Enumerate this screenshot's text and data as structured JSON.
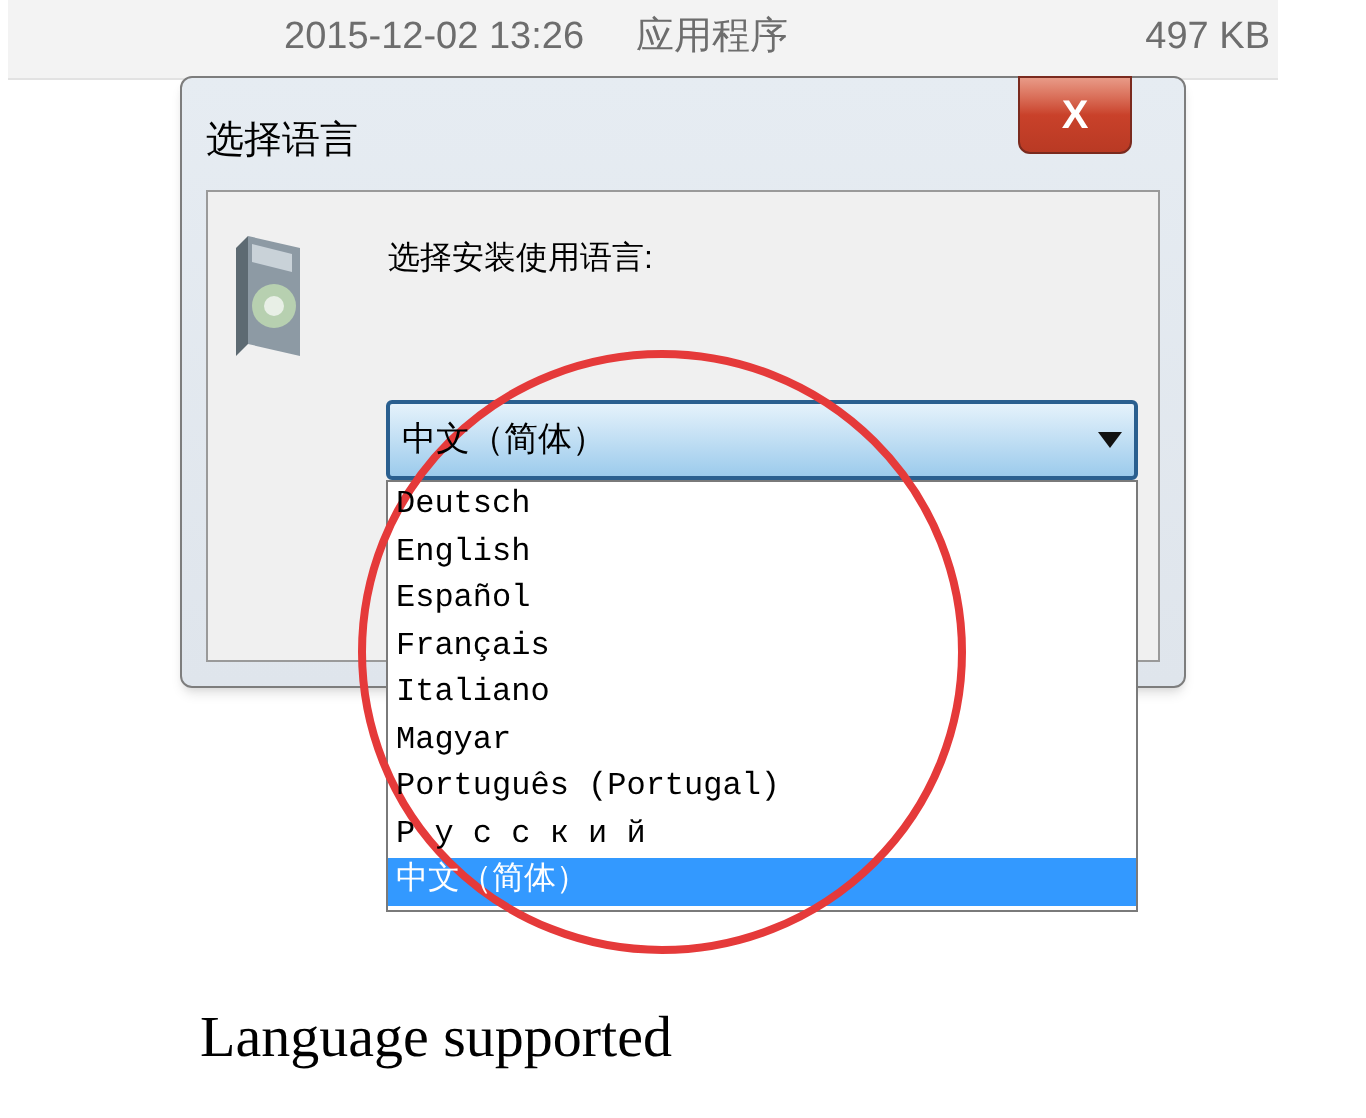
{
  "file_row": {
    "modified": "2015-12-02 13:26",
    "type": "应用程序",
    "size": "497 KB"
  },
  "dialog": {
    "title": "选择语言",
    "close_label": "X",
    "prompt": "选择安装使用语言:",
    "language_select": {
      "value": "中文（简体）",
      "expanded": true,
      "options": [
        {
          "label": "Deutsch",
          "selected": false
        },
        {
          "label": "English",
          "selected": false
        },
        {
          "label": "Español",
          "selected": false
        },
        {
          "label": "Français",
          "selected": false
        },
        {
          "label": "Italiano",
          "selected": false
        },
        {
          "label": "Magyar",
          "selected": false
        },
        {
          "label": "Português (Portugal)",
          "selected": false
        },
        {
          "label": "Р у с с к и й",
          "selected": false
        },
        {
          "label": "中文（简体）",
          "selected": true
        }
      ]
    }
  },
  "caption": "Language supported"
}
